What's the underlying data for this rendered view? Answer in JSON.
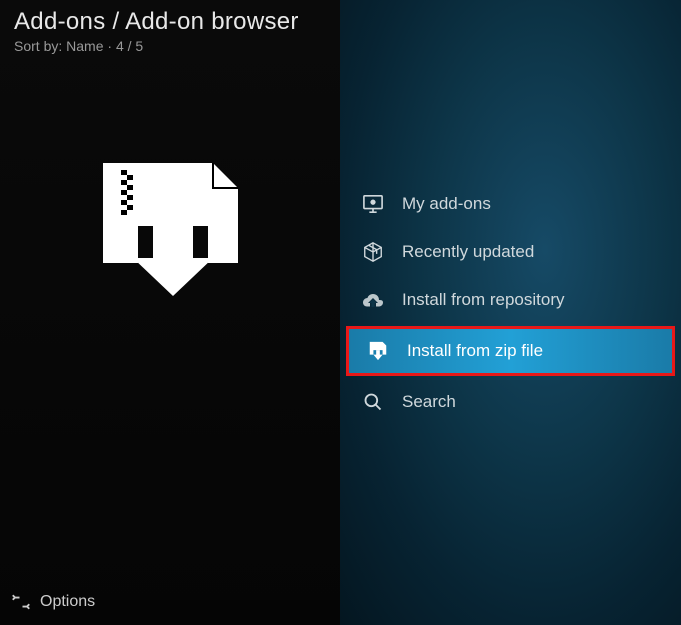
{
  "header": {
    "title": "Add-ons / Add-on browser",
    "sort_prefix": "Sort by: ",
    "sort_value": "Name",
    "counter": "4 / 5"
  },
  "menu": {
    "items": [
      {
        "label": "My add-ons",
        "icon": "monitor-icon"
      },
      {
        "label": "Recently updated",
        "icon": "box-icon"
      },
      {
        "label": "Install from repository",
        "icon": "cloud-download-icon"
      },
      {
        "label": "Install from zip file",
        "icon": "zip-download-icon"
      },
      {
        "label": "Search",
        "icon": "search-icon"
      }
    ]
  },
  "footer": {
    "options_label": "Options"
  }
}
